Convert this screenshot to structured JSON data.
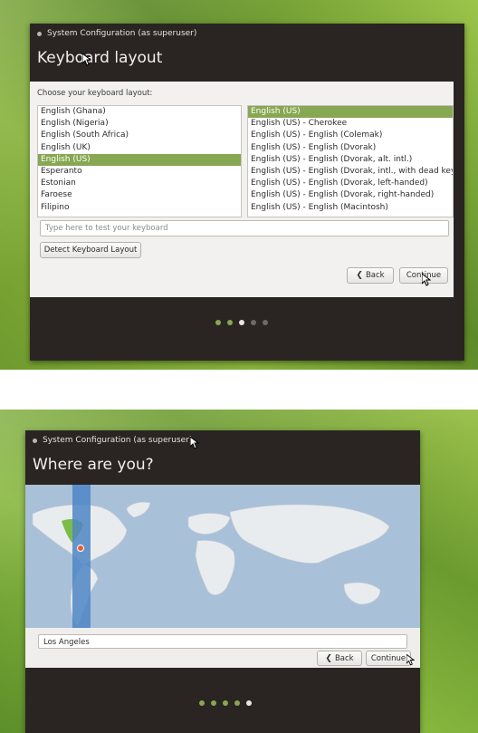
{
  "screen1": {
    "window_title": "System Configuration (as superuser)",
    "heading": "Keyboard layout",
    "caption": "Choose your keyboard layout:",
    "layouts": [
      "English (Ghana)",
      "English (Nigeria)",
      "English (South Africa)",
      "English (UK)",
      "English (US)",
      "Esperanto",
      "Estonian",
      "Faroese",
      "Filipino"
    ],
    "selected_layout_index": 4,
    "variants": [
      "English (US)",
      "English (US) - Cherokee",
      "English (US) - English (Colemak)",
      "English (US) - English (Dvorak)",
      "English (US) - English (Dvorak, alt. intl.)",
      "English (US) - English (Dvorak, intl., with dead keys)",
      "English (US) - English (Dvorak, left-handed)",
      "English (US) - English (Dvorak, right-handed)",
      "English (US) - English (Macintosh)"
    ],
    "selected_variant_index": 0,
    "test_placeholder": "Type here to test your keyboard",
    "detect_label": "Detect Keyboard Layout",
    "back_label": "Back",
    "continue_label": "Continue",
    "progress": {
      "total": 5,
      "completed": 2,
      "current": 3
    }
  },
  "screen2": {
    "window_title": "System Configuration (as superuser)",
    "heading": "Where are you?",
    "location_value": "Los Angeles",
    "back_label": "Back",
    "continue_label": "Continue",
    "progress": {
      "total": 5,
      "completed": 4,
      "current": 5
    }
  },
  "colors": {
    "accent": "#87a752",
    "window_bg": "#2a2522",
    "timezone": "#4f86c6"
  },
  "icons": {
    "back": "chevron-left-icon",
    "title_dot": "window-dot-icon",
    "cursor": "mouse-pointer-icon"
  }
}
